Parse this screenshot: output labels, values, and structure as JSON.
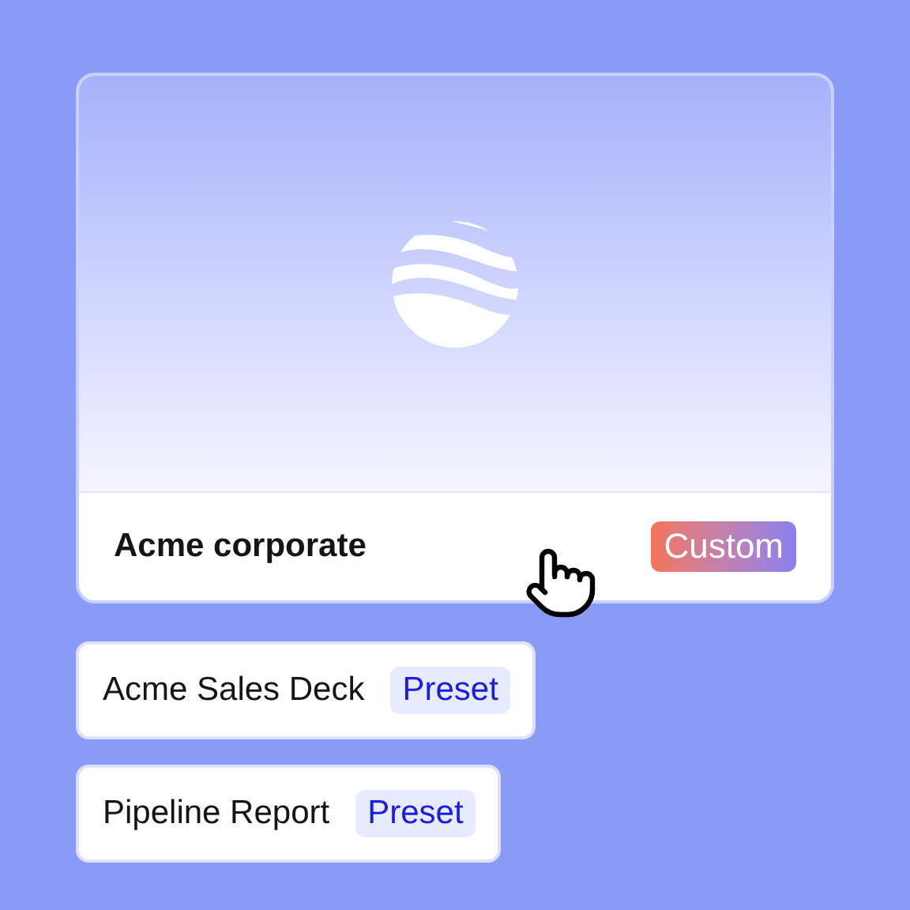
{
  "featured_template": {
    "name": "Acme corporate",
    "badge": {
      "label": "Custom",
      "kind": "custom"
    }
  },
  "templates": [
    {
      "name": "Acme Sales Deck",
      "badge": {
        "label": "Preset",
        "kind": "preset"
      }
    },
    {
      "name": "Pipeline Report",
      "badge": {
        "label": "Preset",
        "kind": "preset"
      }
    }
  ]
}
